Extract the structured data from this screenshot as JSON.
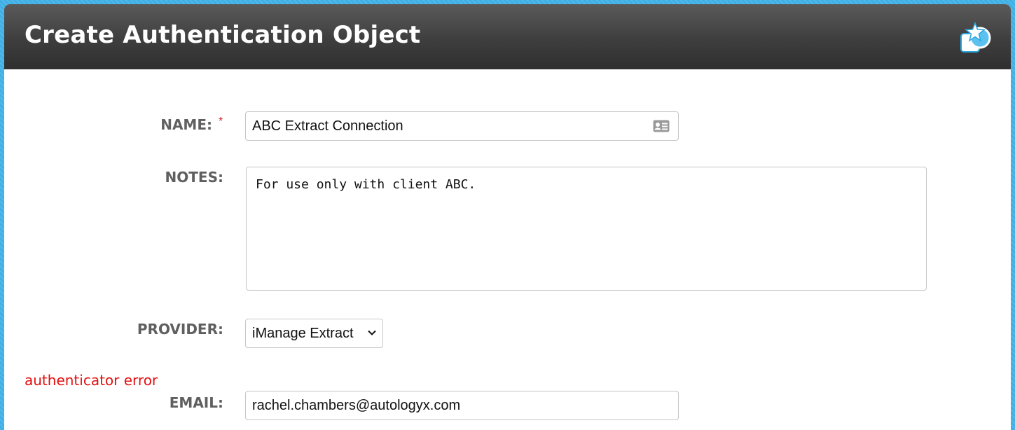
{
  "header": {
    "title": "Create Authentication Object",
    "icon": "star-badge-icon"
  },
  "form": {
    "name": {
      "label": "NAME:",
      "required_marker": "*",
      "value": "ABC Extract Connection",
      "icon": "contact-card-icon"
    },
    "notes": {
      "label": "NOTES:",
      "value": "For use only with client ABC."
    },
    "provider": {
      "label": "PROVIDER:",
      "selected": "iManage Extract"
    },
    "error_text": "authenticator error",
    "email": {
      "label": "EMAIL:",
      "value": "rachel.chambers@autologyx.com"
    }
  },
  "colors": {
    "background": "#3fb0e6",
    "header_dark": "#3e3e3e",
    "label_gray": "#5f5f5f",
    "error_red": "#e40f0f",
    "required_red": "#d42b2b"
  }
}
